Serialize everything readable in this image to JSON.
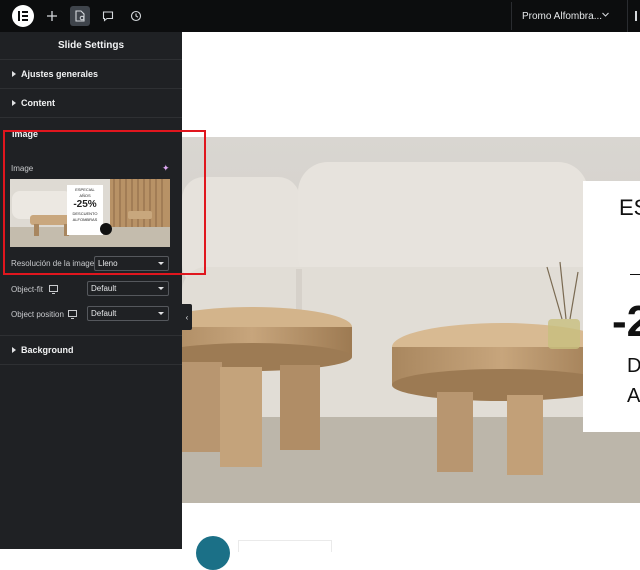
{
  "topbar": {
    "page_name": "Promo Alfombra...",
    "icons": [
      "elementor-logo-icon",
      "add-icon",
      "page-settings-icon",
      "comments-icon",
      "history-icon",
      "chevron-down-icon"
    ]
  },
  "panel": {
    "title": "Slide Settings",
    "sections": {
      "general": "Ajustes generales",
      "content": "Content",
      "image": "Image",
      "background": "Background"
    },
    "image": {
      "image_label": "Image",
      "resolution_label": "Resolución de la imagen",
      "resolution_value": "Lleno",
      "object_fit_label": "Object-fit",
      "object_fit_value": "Default",
      "object_position_label": "Object position",
      "object_position_value": "Default"
    },
    "thumbnail": {
      "line1": "ESPECIAL",
      "line2": "AÑOS",
      "discount": "-25%",
      "line3": "DESCUENTO",
      "line4": "ALFOMBRAS"
    }
  },
  "slide": {
    "text_top": "ES",
    "text_discount": "-2",
    "text_line1": "D",
    "text_line2": "A"
  },
  "colors": {
    "accent_outline": "#e0161e",
    "panel_bg": "#1f2124",
    "topbar_bg": "#0c0d0e",
    "widget_teal": "#1b7087"
  }
}
